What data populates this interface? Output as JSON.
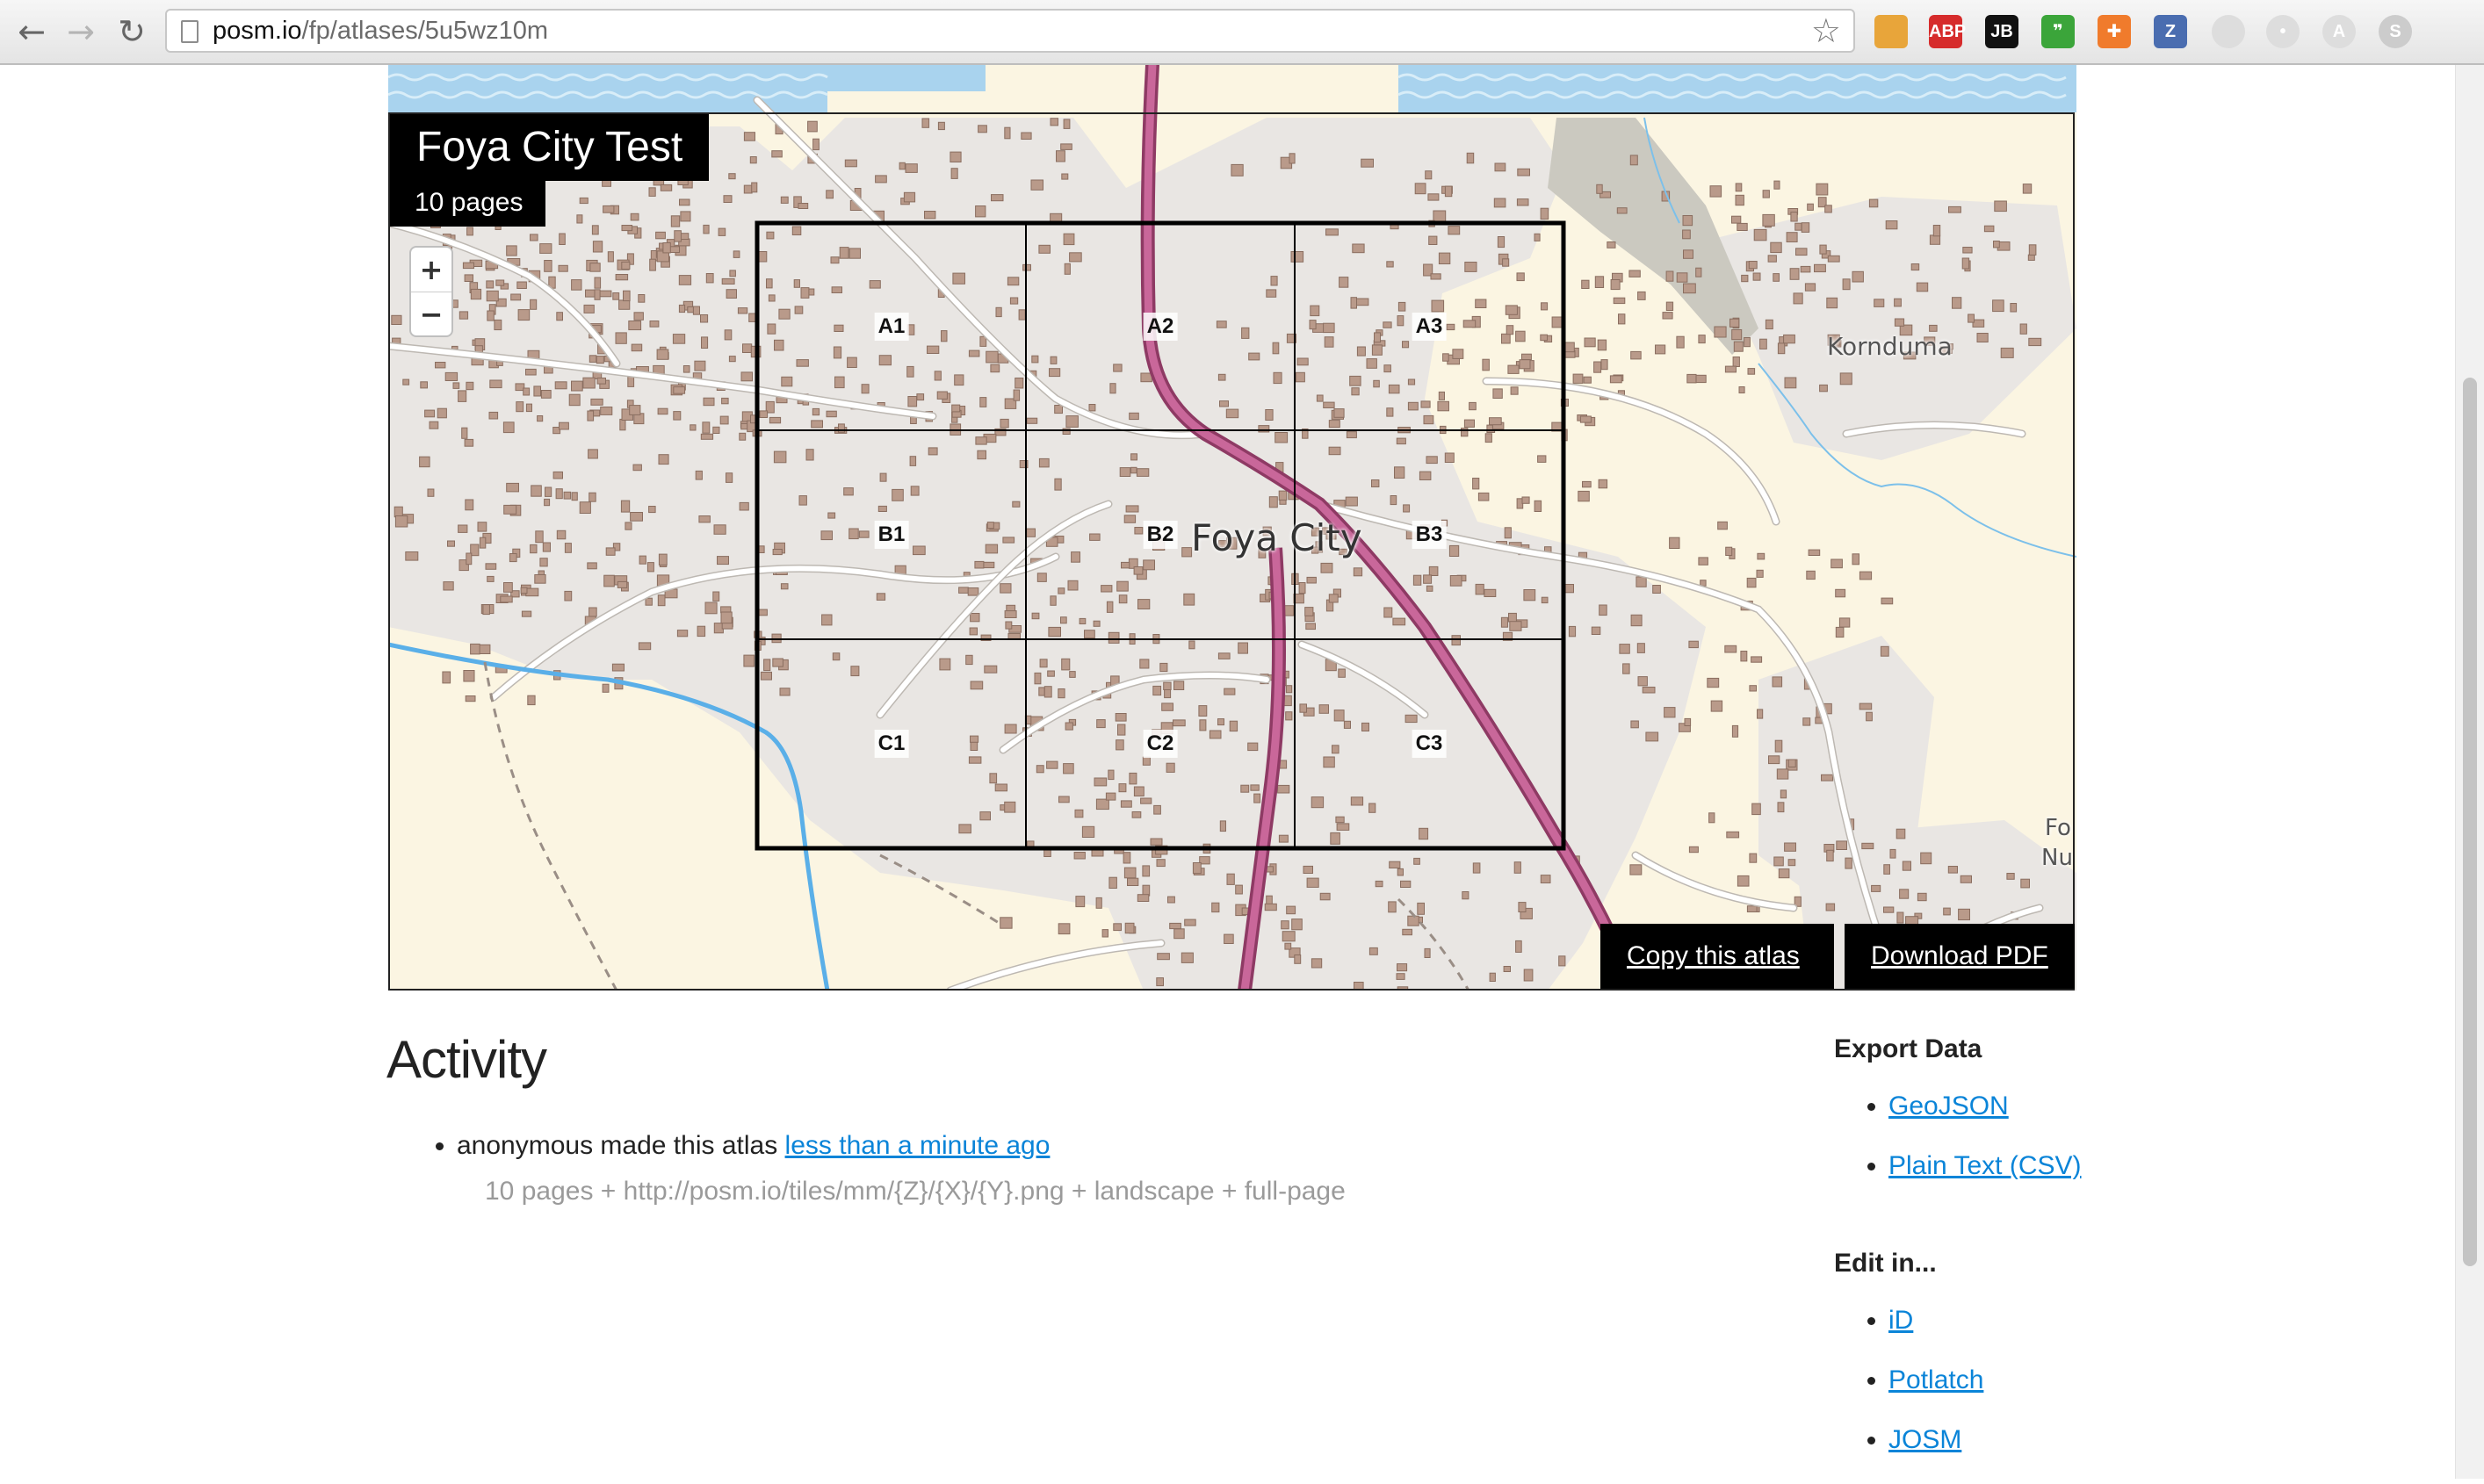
{
  "browser": {
    "back_glyph": "←",
    "forward_glyph": "→",
    "reload_glyph": "↻",
    "url_host": "posm.io",
    "url_path": "/fp/atlases/5u5wz10m",
    "star_glyph": "☆",
    "extensions": [
      {
        "name": "color-wheel-icon",
        "label": "",
        "color": "#e8a53a"
      },
      {
        "name": "adblock-plus-icon",
        "label": "ABP",
        "color": "#d62b2b"
      },
      {
        "name": "jetbrains-icon",
        "label": "JB",
        "color": "#111111"
      },
      {
        "name": "evernote-icon",
        "label": "❞",
        "color": "#3ba53a"
      },
      {
        "name": "lifebuoy-icon",
        "label": "✚",
        "color": "#f07b2c"
      },
      {
        "name": "zotero-icon",
        "label": "Z",
        "color": "#4a6db0"
      },
      {
        "name": "sync-icon",
        "label": "",
        "color": "#dddddd"
      },
      {
        "name": "dot-icon",
        "label": "•",
        "color": "#dddddd"
      },
      {
        "name": "font-a-icon",
        "label": "A",
        "color": "#dddddd"
      },
      {
        "name": "s-icon",
        "label": "S",
        "color": "#cccccc"
      }
    ]
  },
  "atlas": {
    "title": "Foya City Test",
    "pages": "10 pages",
    "grid_labels": [
      {
        "label": "A1",
        "col": 0,
        "row": 0
      },
      {
        "label": "A2",
        "col": 1,
        "row": 0
      },
      {
        "label": "A3",
        "col": 2,
        "row": 0
      },
      {
        "label": "B1",
        "col": 0,
        "row": 1
      },
      {
        "label": "B2",
        "col": 1,
        "row": 1
      },
      {
        "label": "B3",
        "col": 2,
        "row": 1
      },
      {
        "label": "C1",
        "col": 0,
        "row": 2
      },
      {
        "label": "C2",
        "col": 1,
        "row": 2
      },
      {
        "label": "C3",
        "col": 2,
        "row": 2
      }
    ],
    "place_city": "Foya City",
    "place_village": "Korn­duma",
    "place_edge_1": "Fo",
    "place_edge_2": "Nu",
    "zoom_in": "+",
    "zoom_out": "−",
    "copy_button": "Copy this atlas",
    "download_button": "Download PDF",
    "colors": {
      "road": "#b0477f",
      "water": "#5aafe8",
      "land": "#fbf5e2",
      "urban": "#e9e6e3",
      "building": "#b99a8a"
    }
  },
  "activity": {
    "heading": "Activity",
    "entry_text": "anonymous made this atlas ",
    "entry_link": "less than a minute ago",
    "entry_meta": "10 pages + http://posm.io/tiles/mm/{Z}/{X}/{Y}.png + landscape + full-page"
  },
  "export": {
    "heading": "Export Data",
    "links": [
      "GeoJSON",
      "Plain Text (CSV)"
    ]
  },
  "edit": {
    "heading": "Edit in...",
    "links": [
      "iD",
      "Potlatch",
      "JOSM"
    ]
  }
}
